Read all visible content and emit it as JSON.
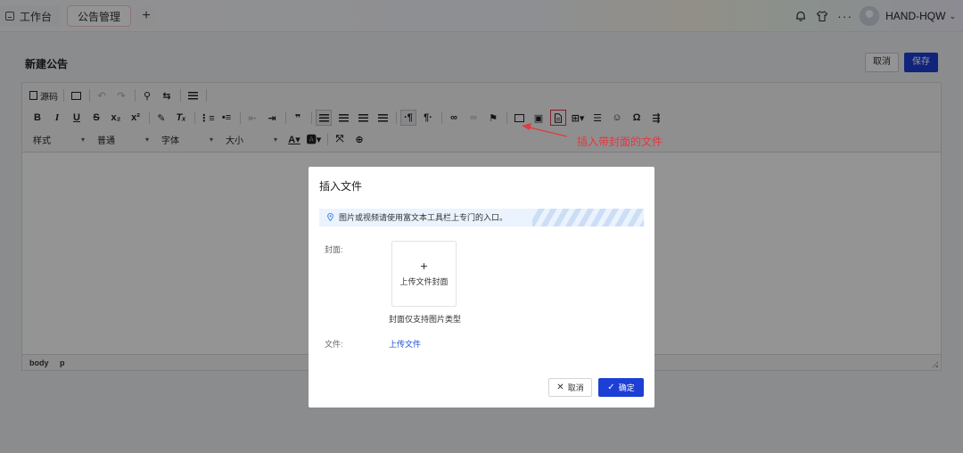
{
  "tabs": {
    "home_label": "工作台",
    "active_label": "公告管理",
    "add_label": "+"
  },
  "header": {
    "more": "···",
    "username": "HAND-HQW",
    "chevron": "⌄"
  },
  "page": {
    "title": "新建公告",
    "cancel_label": "取消",
    "save_label": "保存"
  },
  "toolbar": {
    "source_label": "源码",
    "style_select": "样式",
    "format_select": "普通",
    "font_select": "字体",
    "size_select": "大小"
  },
  "statusbar": {
    "path_body": "body",
    "path_p": "p"
  },
  "annotation": {
    "text": "插入带封面的文件",
    "color": "#e3393f"
  },
  "dialog": {
    "title": "插入文件",
    "notice": "图片或视频请使用富文本工具栏上专门的入口。",
    "cover_label": "封面:",
    "upload_plus": "+",
    "upload_cover_label": "上传文件封面",
    "cover_hint": "封面仅支持图片类型",
    "file_label": "文件:",
    "upload_file_link": "上传文件",
    "cancel_label": "取消",
    "ok_label": "确定"
  },
  "colors": {
    "primary": "#1d3fd6",
    "link": "#1a4fd6",
    "annotation": "#e3393f"
  }
}
